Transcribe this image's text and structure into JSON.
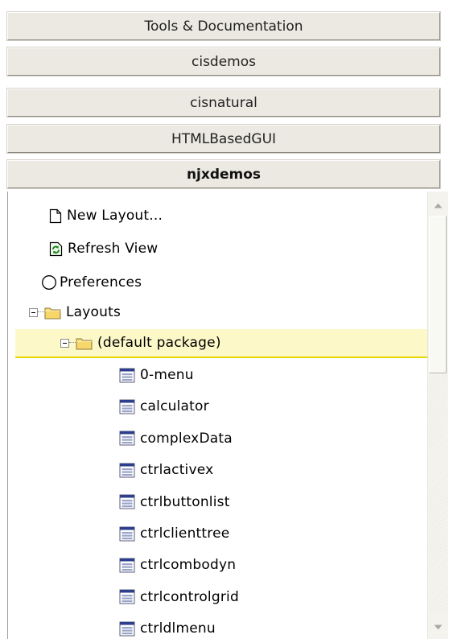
{
  "sections": [
    {
      "label": "Tools & Documentation",
      "active": false
    },
    {
      "label": "cisdemos",
      "active": false
    },
    {
      "label": "cisnatural",
      "active": false
    },
    {
      "label": "HTMLBasedGUI",
      "active": false
    },
    {
      "label": "njxdemos",
      "active": true
    }
  ],
  "tree": {
    "actions": [
      {
        "label": "New Layout...",
        "icon": "new-document-icon"
      },
      {
        "label": "Refresh View",
        "icon": "refresh-icon"
      },
      {
        "label": "Preferences",
        "icon": "circle-icon"
      }
    ],
    "folders": {
      "layouts": {
        "label": "Layouts",
        "icon": "folder-icon",
        "expanded": true
      },
      "default_package": {
        "label": "(default package)",
        "icon": "folder-icon",
        "expanded": true,
        "selected": true
      }
    },
    "layouts": [
      "0-menu",
      "calculator",
      "complexData",
      "ctrlactivex",
      "ctrlbuttonlist",
      "ctrlclienttree",
      "ctrlcombodyn",
      "ctrlcontrolgrid",
      "ctrldlmenu"
    ]
  },
  "colors": {
    "selected_row_bg": "#fdf8c8",
    "selected_row_underline": "#e8d800",
    "button_face": "#ebe9e1",
    "layout_icon_header": "#2b3f8c"
  }
}
